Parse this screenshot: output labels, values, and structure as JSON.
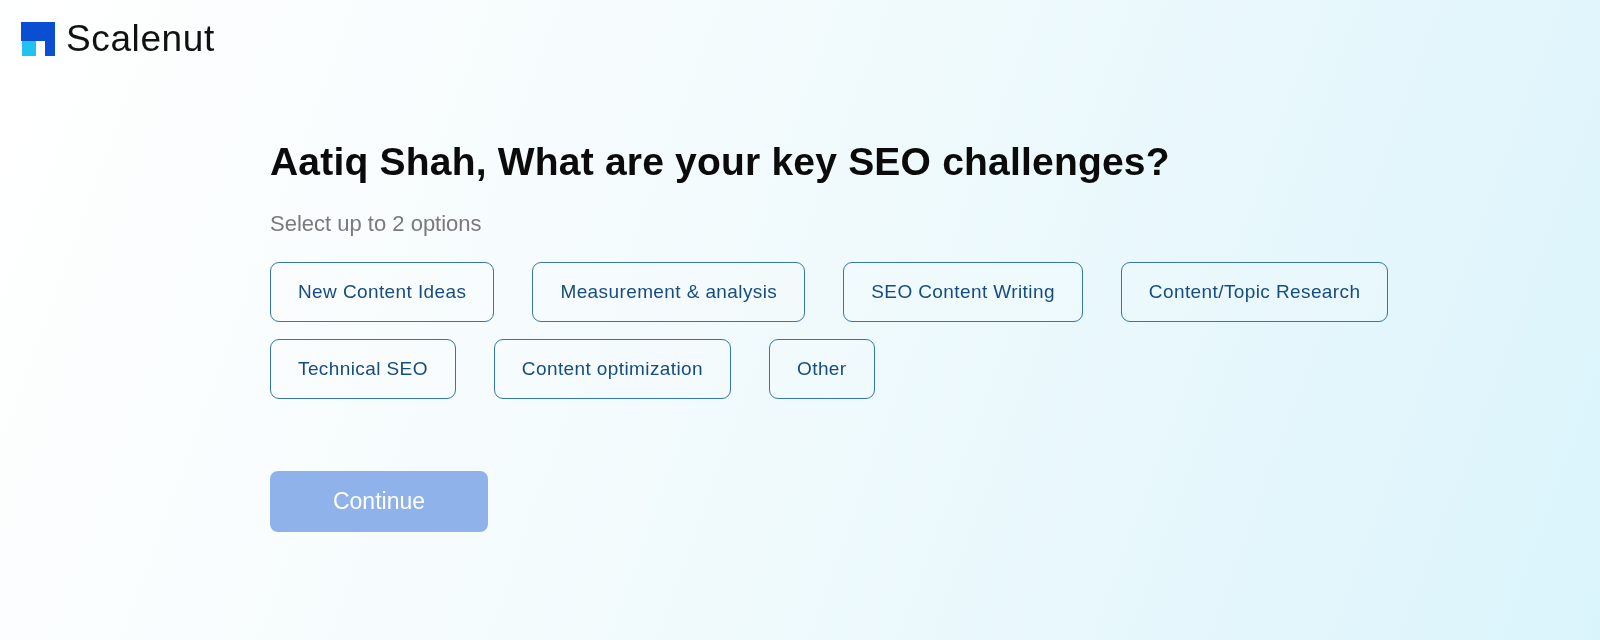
{
  "brand": {
    "name": "Scalenut"
  },
  "question": {
    "title": "Aatiq Shah, What are your key SEO challenges?",
    "hint": "Select up to 2 options"
  },
  "options": [
    {
      "label": "New Content Ideas",
      "selected": false
    },
    {
      "label": "Measurement & analysis",
      "selected": false
    },
    {
      "label": "SEO Content Writing",
      "selected": false
    },
    {
      "label": "Content/Topic Research",
      "selected": false
    },
    {
      "label": "Technical SEO",
      "selected": false
    },
    {
      "label": "Content optimization",
      "selected": false
    },
    {
      "label": "Other",
      "selected": false
    }
  ],
  "continue_button": {
    "label": "Continue",
    "disabled": true
  }
}
